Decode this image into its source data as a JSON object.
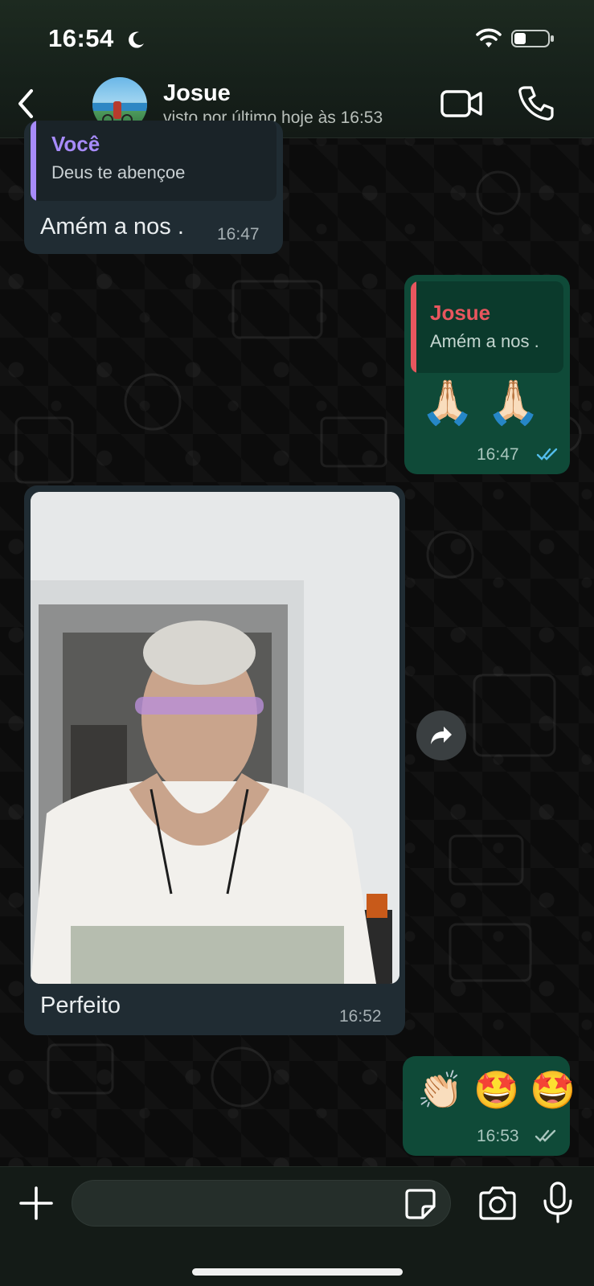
{
  "status_bar": {
    "time": "16:54"
  },
  "header": {
    "contact_name": "Josue",
    "last_seen": "visto por último hoje às 16:53"
  },
  "messages": [
    {
      "direction": "incoming",
      "quote_author": "Você",
      "quote_text": "Deus te abençoe",
      "text": "Amém a nos .",
      "time": "16:47"
    },
    {
      "direction": "outgoing",
      "quote_author": "Josue",
      "quote_text": "Amém a nos .",
      "text": "🙏🏻 🙏🏻",
      "time": "16:47",
      "status": "read"
    },
    {
      "direction": "incoming",
      "type": "image",
      "caption": "Perfeito",
      "time": "16:52"
    },
    {
      "direction": "outgoing",
      "text": "👏🏻 🤩 🤩",
      "time": "16:53",
      "status": "delivered"
    }
  ],
  "colors": {
    "incoming_bubble": "#202c33",
    "outgoing_bubble": "#005c4b",
    "quote_you_accent": "#a78bfa",
    "quote_josue_accent": "#e8565e",
    "read_check": "#53bdeb",
    "delivered_check": "#a8c5bd"
  },
  "composer": {
    "placeholder": ""
  }
}
